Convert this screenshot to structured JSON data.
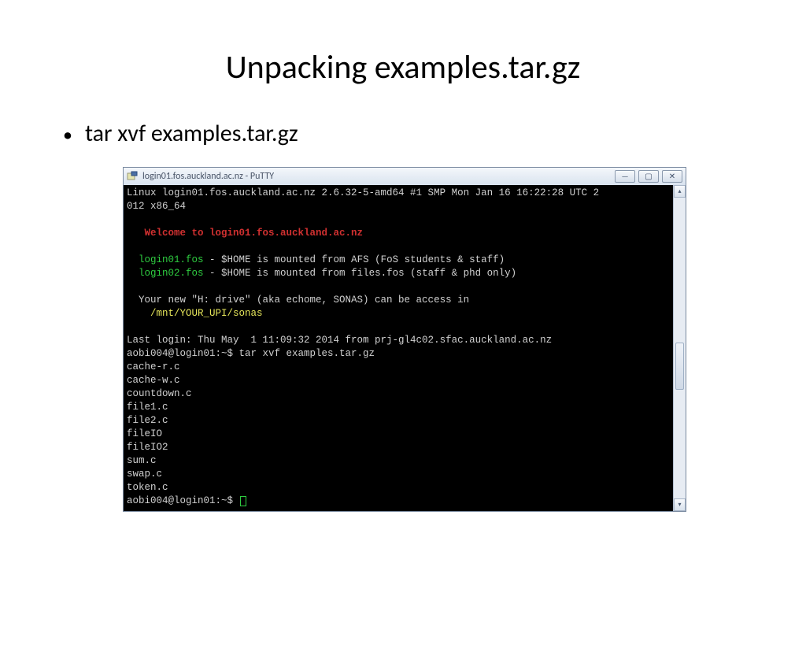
{
  "slide": {
    "title": "Unpacking examples.tar.gz",
    "bullet": "tar xvf examples.tar.gz"
  },
  "window": {
    "title": "login01.fos.auckland.ac.nz - PuTTY",
    "buttons": {
      "min": "—",
      "max": "▢",
      "close": "✕"
    },
    "scroll": {
      "up": "▴",
      "down": "▾"
    }
  },
  "terminal": {
    "line1a": "Linux login01.fos.auckland.ac.nz 2.6.32-5-amd64 #1 SMP Mon Jan 16 16:22:28 UTC 2",
    "line1b": "012 x86_64",
    "blank": "",
    "msg_indent": "   ",
    "welcome": "Welcome to login01.fos.auckland.ac.nz",
    "host_indent": "  ",
    "login01": "login01.fos",
    "login01_rest": " - $HOME is mounted from AFS (FoS students & staff)",
    "login02": "login02.fos",
    "login02_rest": " - $HOME is mounted from files.fos (staff & phd only)",
    "hdrive": "  Your new \"H: drive\" (aka echome, SONAS) can be access in",
    "sonas_indent": "    ",
    "sonas": "/mnt/YOUR_UPI/sonas",
    "lastlogin": "Last login: Thu May  1 11:09:32 2014 from prj-gl4c02.sfac.auckland.ac.nz",
    "prompt1a": "aobi004@login01:~$ ",
    "cmd": "tar xvf examples.tar.gz",
    "f1": "cache-r.c",
    "f2": "cache-w.c",
    "f3": "countdown.c",
    "f4": "file1.c",
    "f5": "file2.c",
    "f6": "fileIO",
    "f7": "fileIO2",
    "f8": "sum.c",
    "f9": "swap.c",
    "f10": "token.c",
    "prompt2": "aobi004@login01:~$ "
  }
}
